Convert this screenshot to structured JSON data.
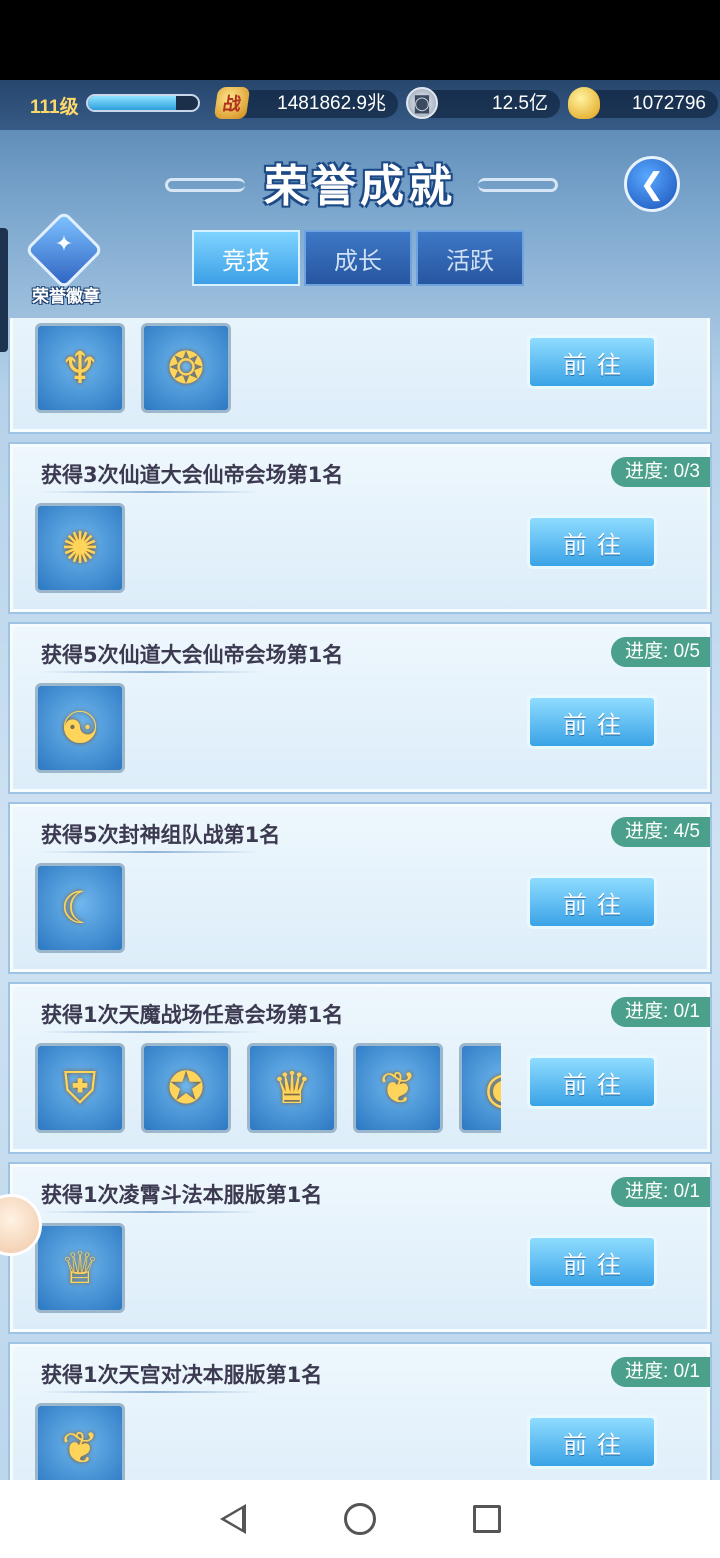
{
  "resources": {
    "level": "111级",
    "exp_fraction": 0.8,
    "power": "1481862.9兆",
    "coins": "12.5亿",
    "ingots": "1072796"
  },
  "header": {
    "title": "荣誉成就",
    "back_icon": "chevron-left-icon"
  },
  "badge": {
    "label": "荣誉徽章"
  },
  "tabs": [
    {
      "label": "竞技",
      "active": true
    },
    {
      "label": "成长",
      "active": false
    },
    {
      "label": "活跃",
      "active": false
    }
  ],
  "achievements": [
    {
      "title": "",
      "progress": "",
      "rewards": [
        "wings-icon",
        "dragon-ornament-icon"
      ],
      "button": "前往"
    },
    {
      "title": "获得3次仙道大会仙帝会场第1名",
      "progress": "进度: 0/3",
      "rewards": [
        "golden-phoenix-icon"
      ],
      "button": "前往"
    },
    {
      "title": "获得5次仙道大会仙帝会场第1名",
      "progress": "进度: 0/5",
      "rewards": [
        "yin-yang-icon"
      ],
      "button": "前往"
    },
    {
      "title": "获得5次封神组队战第1名",
      "progress": "进度: 4/5",
      "rewards": [
        "crescent-emblem-icon"
      ],
      "button": "前往"
    },
    {
      "title": "获得1次天魔战场任意会场第1名",
      "progress": "进度: 0/1",
      "rewards": [
        "helmet-icon",
        "medal-icon",
        "crown-wings-icon",
        "flame-wings-icon",
        "orb-icon"
      ],
      "button": "前往"
    },
    {
      "title": "获得1次凌霄斗法本服版第1名",
      "progress": "进度: 0/1",
      "rewards": [
        "crown-icon"
      ],
      "button": "前往"
    },
    {
      "title": "获得1次天宫对决本服版第1名",
      "progress": "进度: 0/1",
      "rewards": [
        "flame-wings-icon"
      ],
      "button": "前往"
    }
  ]
}
